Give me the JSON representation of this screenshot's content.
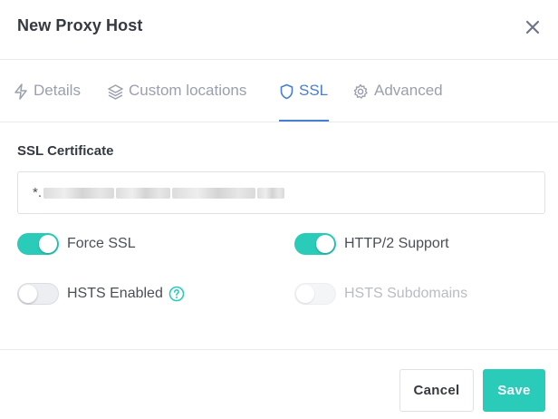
{
  "header": {
    "title": "New Proxy Host"
  },
  "tabs": [
    {
      "label": "Details",
      "icon": "lightning-icon"
    },
    {
      "label": "Custom locations",
      "icon": "layers-icon"
    },
    {
      "label": "SSL",
      "icon": "shield-icon",
      "active": true
    },
    {
      "label": "Advanced",
      "icon": "gear-icon"
    }
  ],
  "ssl": {
    "certificate_label": "SSL Certificate",
    "certificate_value_prefix": "*."
  },
  "options": {
    "force_ssl": {
      "label": "Force SSL",
      "enabled": true
    },
    "http2": {
      "label": "HTTP/2 Support",
      "enabled": true
    },
    "hsts": {
      "label": "HSTS Enabled",
      "enabled": false
    },
    "hsts_subdomains": {
      "label": "HSTS Subdomains",
      "enabled": false,
      "disabled": true
    }
  },
  "footer": {
    "cancel_label": "Cancel",
    "save_label": "Save"
  },
  "colors": {
    "accent": "#2bcbba",
    "active_tab": "#467fcf"
  }
}
